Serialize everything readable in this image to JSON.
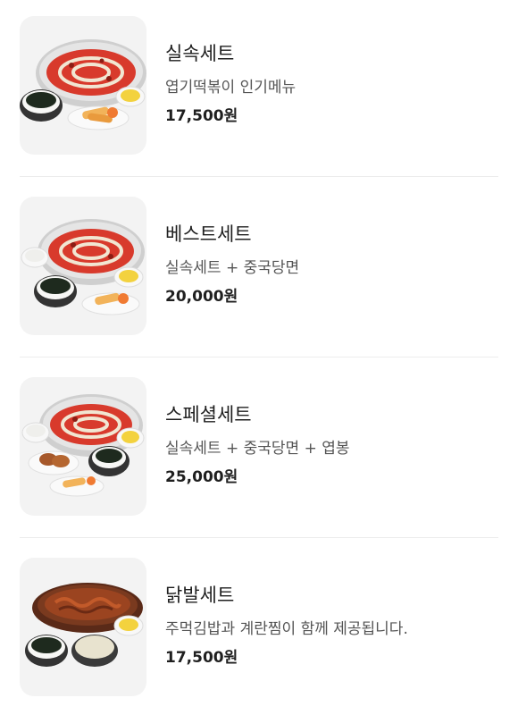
{
  "menu": {
    "items": [
      {
        "name": "실속세트",
        "description": "엽기떡볶이 인기메뉴",
        "price": "17,500원",
        "image_icon": "tteokbokki-set-image"
      },
      {
        "name": "베스트세트",
        "description": "실속세트 + 중국당면",
        "price": "20,000원",
        "image_icon": "tteokbokki-set-image"
      },
      {
        "name": "스페셜세트",
        "description": "실속세트 + 중국당면 + 엽봉",
        "price": "25,000원",
        "image_icon": "tteokbokki-set-image"
      },
      {
        "name": "닭발세트",
        "description": "주먹김밥과 계란찜이 함께 제공됩니다.",
        "price": "17,500원",
        "image_icon": "chicken-feet-set-image"
      }
    ]
  },
  "colors": {
    "sauce_red": "#d83a2c",
    "pot_gray": "#c7c7c7",
    "tile_bg": "#f3f3f3",
    "divider": "#ececec"
  }
}
